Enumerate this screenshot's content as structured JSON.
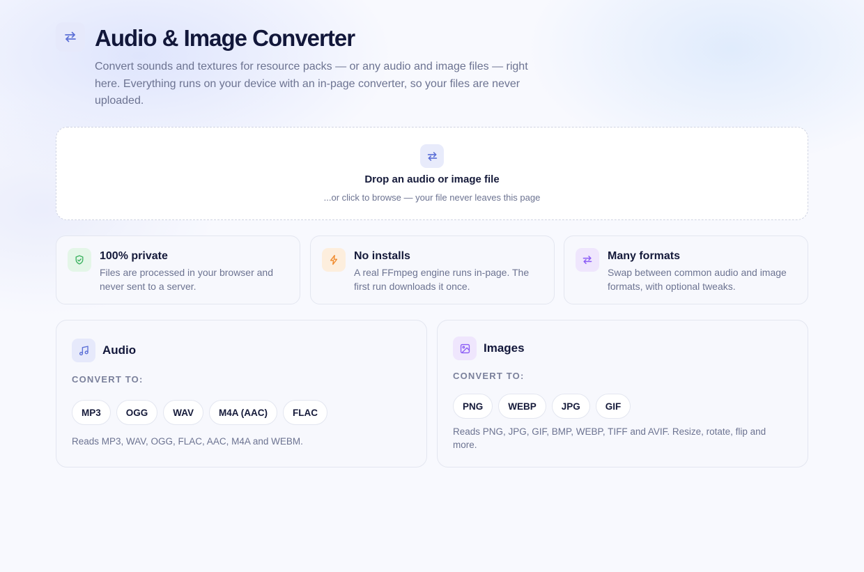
{
  "header": {
    "title": "Audio & Image Converter",
    "subtitle": "Convert sounds and textures for resource packs — or any audio and image files — right here. Everything runs on your device with an in-page converter, so your files are never uploaded.",
    "icon": "swap-arrows-icon"
  },
  "dropzone": {
    "title": "Drop an audio or image file",
    "subtitle": "...or click to browse — your file never leaves this page",
    "icon": "swap-arrows-icon"
  },
  "features": [
    {
      "title": "100% private",
      "description": "Files are processed in your browser and never sent to a server.",
      "icon": "shield-check-icon",
      "color": "#3bb25f"
    },
    {
      "title": "No installs",
      "description": "A real FFmpeg engine runs in-page. The first run downloads it once.",
      "icon": "lightning-icon",
      "color": "#f08a2c"
    },
    {
      "title": "Many formats",
      "description": "Swap between common audio and image formats, with optional tweaks.",
      "icon": "swap-arrows-icon",
      "color": "#8b5cf6"
    }
  ],
  "audio": {
    "title": "Audio",
    "convert_label": "CONVERT TO:",
    "formats": [
      "MP3",
      "OGG",
      "WAV",
      "M4A (AAC)",
      "FLAC"
    ],
    "note": "Reads MP3, WAV, OGG, FLAC, AAC, M4A and WEBM.",
    "icon": "music-note-icon"
  },
  "images": {
    "title": "Images",
    "convert_label": "CONVERT TO:",
    "formats": [
      "PNG",
      "WEBP",
      "JPG",
      "GIF"
    ],
    "note": "Reads PNG, JPG, GIF, BMP, WEBP, TIFF and AVIF. Resize, rotate, flip and more.",
    "icon": "image-icon"
  },
  "colors": {
    "accent_blue": "#5b6fd6",
    "accent_purple": "#8b5cf6",
    "text_dark": "#12173a",
    "text_muted": "#6c7391"
  }
}
